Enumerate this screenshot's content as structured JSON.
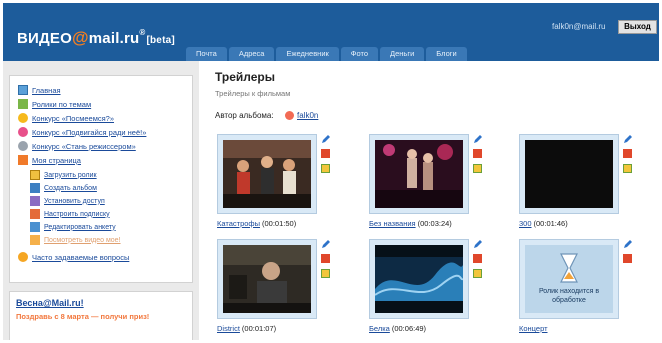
{
  "header": {
    "logo_part1": "ВИДЕО",
    "logo_at": "@",
    "logo_part2": "mail.ru",
    "logo_reg": "®",
    "logo_beta": "[beta]",
    "user_email": "falk0n@mail.ru",
    "logout_label": "Выход"
  },
  "tabs": [
    {
      "label": "Почта"
    },
    {
      "label": "Адреса"
    },
    {
      "label": "Ежедневник"
    },
    {
      "label": "Фото"
    },
    {
      "label": "Деньги"
    },
    {
      "label": "Блоги"
    }
  ],
  "sidebar": {
    "items": [
      {
        "label": "Главная",
        "icon": "home-icon"
      },
      {
        "label": "Ролики по темам",
        "icon": "topics-icon"
      },
      {
        "label": "Конкурс «Посмеемся?»",
        "icon": "contest-icon"
      },
      {
        "label": "Конкурс «Подвигайся ради неё!»",
        "icon": "contest-icon"
      },
      {
        "label": "Конкурс «Стань режиссером»",
        "icon": "contest-icon"
      },
      {
        "label": "Моя страница",
        "icon": "my-page-icon"
      }
    ],
    "sub_items": [
      {
        "label": "Загрузить ролик",
        "icon": "upload-icon"
      },
      {
        "label": "Создать альбом",
        "icon": "album-icon"
      },
      {
        "label": "Установить доступ",
        "icon": "access-icon"
      },
      {
        "label": "Настроить подписку",
        "icon": "subscription-icon"
      },
      {
        "label": "Редактировать анкету",
        "icon": "edit-profile-icon"
      },
      {
        "label": "Посмотреть видео мое!",
        "icon": "view-icon"
      }
    ],
    "faq": {
      "label": "Часто задаваемые вопросы",
      "icon": "faq-icon"
    }
  },
  "promo": {
    "title": "Весна@Mail.ru!",
    "text": "Поздравь с 8 марта — получи приз!"
  },
  "main": {
    "title": "Трейлеры",
    "subtitle": "Трейлеры к фильмам",
    "author_label": "Автор альбома:",
    "author_name": "falk0n"
  },
  "videos": [
    {
      "title": "Катастрофы",
      "duration": "(00:01:50)",
      "thumb": "colorful-stage"
    },
    {
      "title": "Без названия",
      "duration": "(00:03:24)",
      "thumb": "concert"
    },
    {
      "title": "300",
      "duration": "(00:01:46)",
      "thumb": "dark"
    },
    {
      "title": "District",
      "duration": "(00:01:07)",
      "thumb": "man-talking"
    },
    {
      "title": "Белка",
      "duration": "(00:06:49)",
      "thumb": "wave"
    },
    {
      "title": "Концерт",
      "duration": "",
      "thumb": "processing",
      "processing_msg": "Ролик находится в обработке"
    }
  ],
  "colors": {
    "header_bg": "#1d5c9b",
    "tab_bg": "#3a78b6",
    "link": "#1a4a9a",
    "accent_orange": "#f57f20",
    "sidebar_bg": "#eaeaea"
  }
}
